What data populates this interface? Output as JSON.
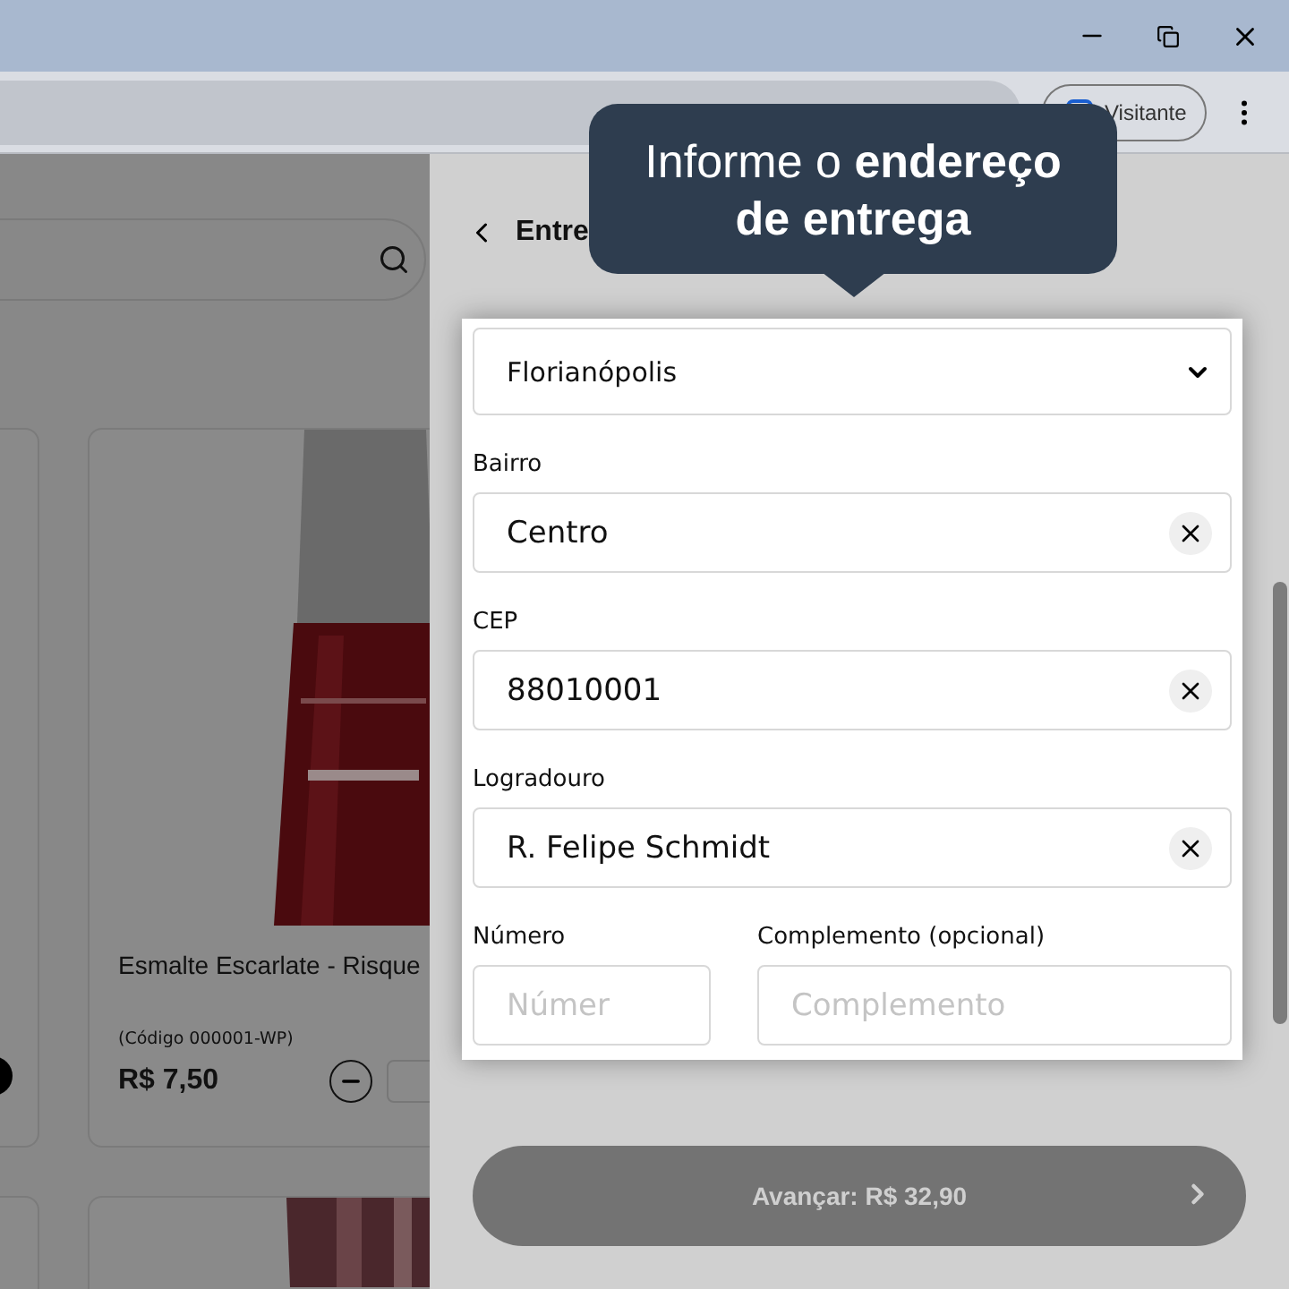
{
  "browser": {
    "profile_chip": {
      "label": "Visitante"
    }
  },
  "catalog": {
    "products": [
      {
        "kind": "partial"
      },
      {
        "kind": "full",
        "name": "Esmalte Escarlate - Risque",
        "code": "(Código 000001-WP)",
        "price": "R$ 7,50"
      },
      {
        "kind": "image_only"
      },
      {
        "kind": "image_only"
      }
    ]
  },
  "panel": {
    "title": "Entre",
    "fields": [
      {
        "kind": "select",
        "value": "Florianópolis"
      },
      {
        "kind": "text",
        "label": "Bairro",
        "value": "Centro",
        "clearable": true
      },
      {
        "kind": "text",
        "label": "CEP",
        "value": "88010001",
        "clearable": true
      },
      {
        "kind": "text",
        "label": "Logradouro",
        "value": "R. Felipe Schmidt",
        "clearable": true
      }
    ],
    "pair": [
      {
        "label": "Número",
        "placeholder": "Númer"
      },
      {
        "label": "Complemento (opcional)",
        "placeholder": "Complemento"
      }
    ],
    "submit": {
      "label": "Avançar: R$ 32,90",
      "disabled": true
    }
  },
  "tooltip": {
    "text": "Informe o **endereço de entrega**"
  }
}
